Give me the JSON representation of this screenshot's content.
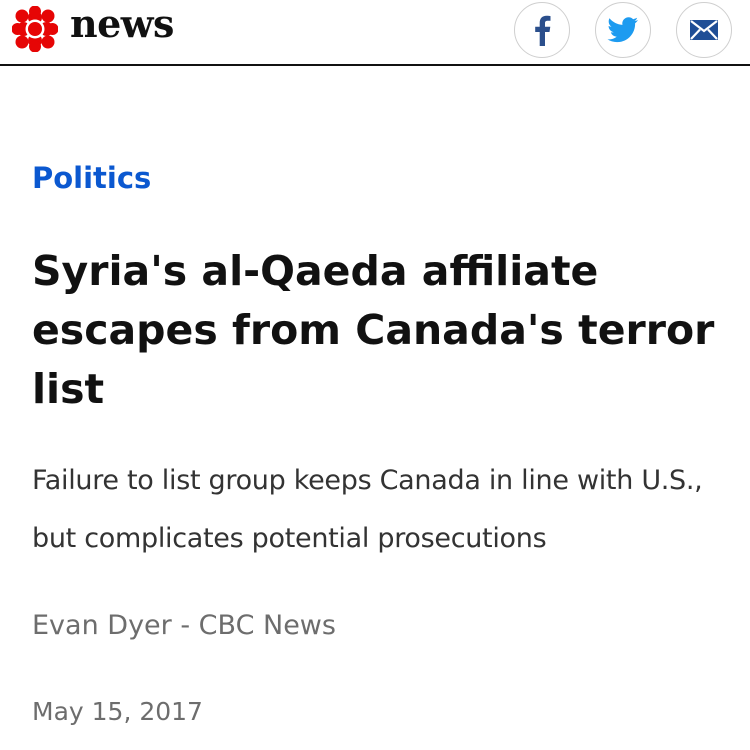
{
  "header": {
    "brand": "news",
    "logo_color": "#e60505",
    "share_buttons": [
      {
        "icon": "facebook-icon",
        "color": "#2b4f8c"
      },
      {
        "icon": "twitter-icon",
        "color": "#1d9bf0"
      },
      {
        "icon": "email-icon",
        "color": "#1f4e96"
      }
    ]
  },
  "article": {
    "section": "Politics",
    "headline": "Syria's al-Qaeda affiliate escapes from Canada's terror list",
    "deck": "Failure to list group keeps Canada in line with U.S., but complicates potential prosecutions",
    "byline": "Evan Dyer - CBC News",
    "date": "May 15, 2017"
  },
  "colors": {
    "section_link": "#0b58d0",
    "headline": "#111111",
    "meta_text": "#6d6d6d"
  }
}
